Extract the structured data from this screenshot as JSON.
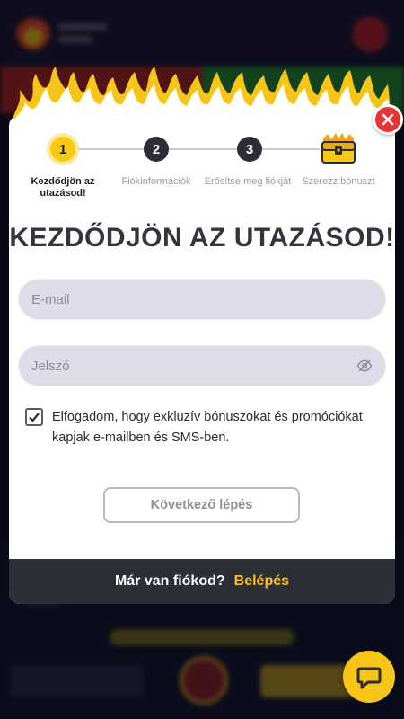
{
  "stepper": {
    "steps": [
      {
        "number": "1",
        "label": "Kezdődjön az utazásod!",
        "state": "active"
      },
      {
        "number": "2",
        "label": "Fiókinformációk",
        "state": "upcoming"
      },
      {
        "number": "3",
        "label": "Erősítse meg fiókját",
        "state": "upcoming"
      },
      {
        "number": "",
        "label": "Szerezz bónuszt",
        "state": "upcoming",
        "icon": "treasure-chest-icon"
      }
    ]
  },
  "title": "KEZDŐDJÖN AZ UTAZÁSOD!",
  "form": {
    "email": {
      "placeholder": "E-mail",
      "value": ""
    },
    "password": {
      "placeholder": "Jelszó",
      "value": "",
      "icon": "eye-off-icon"
    },
    "consent": {
      "checked": true,
      "label": "Elfogadom, hogy exkluzív bónuszokat és promóciókat kapjak e-mailben és SMS-ben."
    },
    "next_label": "Következő lépés"
  },
  "footer": {
    "question": "Már van fiókod?",
    "login_label": "Belépés"
  },
  "colors": {
    "accent": "#f6c915",
    "close": "#e53532",
    "footer_bg": "#2d2f38",
    "link": "#f6c218"
  },
  "icons": {
    "close": "close-icon",
    "chat": "chat-bubble-icon"
  }
}
